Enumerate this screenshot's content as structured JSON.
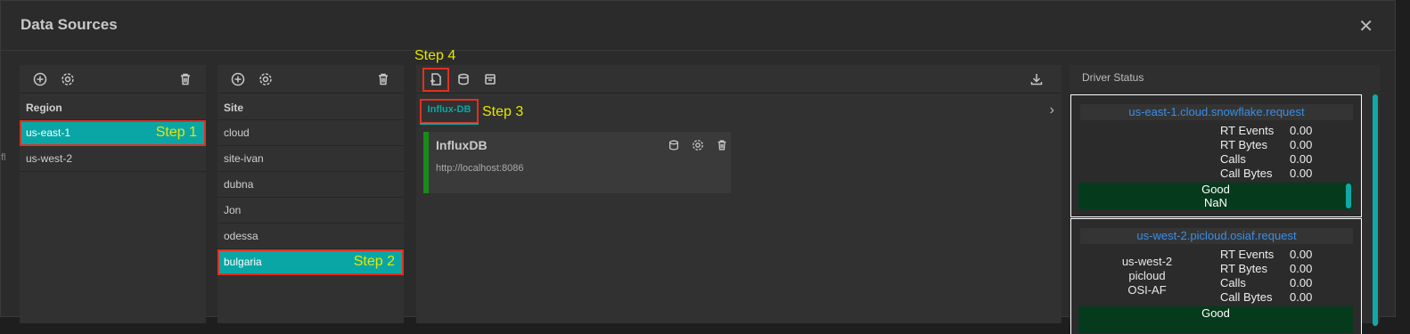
{
  "dialog": {
    "title": "Data Sources",
    "close_icon": "close-icon",
    "edge_text": "fl"
  },
  "region_panel": {
    "header": "Region",
    "toolbar": [
      "add-icon",
      "gear-icon",
      "trash-icon"
    ],
    "items": [
      {
        "label": "us-east-1",
        "selected": true,
        "step": "Step 1"
      },
      {
        "label": "us-west-2",
        "selected": false
      }
    ]
  },
  "site_panel": {
    "header": "Site",
    "toolbar": [
      "add-icon",
      "gear-icon",
      "trash-icon"
    ],
    "items": [
      {
        "label": "cloud"
      },
      {
        "label": "site-ivan"
      },
      {
        "label": "dubna"
      },
      {
        "label": "Jon"
      },
      {
        "label": "odessa"
      },
      {
        "label": "bulgaria",
        "selected": true,
        "step": "Step 2"
      }
    ]
  },
  "drivers_panel": {
    "step4": "Step 4",
    "step3": "Step 3",
    "tab": "Influx-DB",
    "card": {
      "title": "InfluxDB",
      "url": "http://localhost:8086"
    }
  },
  "driver_status": {
    "header": "Driver Status",
    "cards": [
      {
        "name": "us-east-1.cloud.snowflake.request",
        "metrics": [
          {
            "label": "RT Events",
            "value": "0.00"
          },
          {
            "label": "RT Bytes",
            "value": "0.00"
          },
          {
            "label": "Calls",
            "value": "0.00"
          },
          {
            "label": "Call Bytes",
            "value": "0.00"
          }
        ],
        "status_line1": "Good",
        "status_line2": "NaN"
      },
      {
        "name": "us-west-2.picloud.osiaf.request",
        "info": [
          "us-west-2",
          "picloud",
          "OSI-AF"
        ],
        "metrics": [
          {
            "label": "RT Events",
            "value": "0.00"
          },
          {
            "label": "RT Bytes",
            "value": "0.00"
          },
          {
            "label": "Calls",
            "value": "0.00"
          },
          {
            "label": "Call Bytes",
            "value": "0.00"
          }
        ],
        "status_line1": "Good"
      }
    ]
  }
}
